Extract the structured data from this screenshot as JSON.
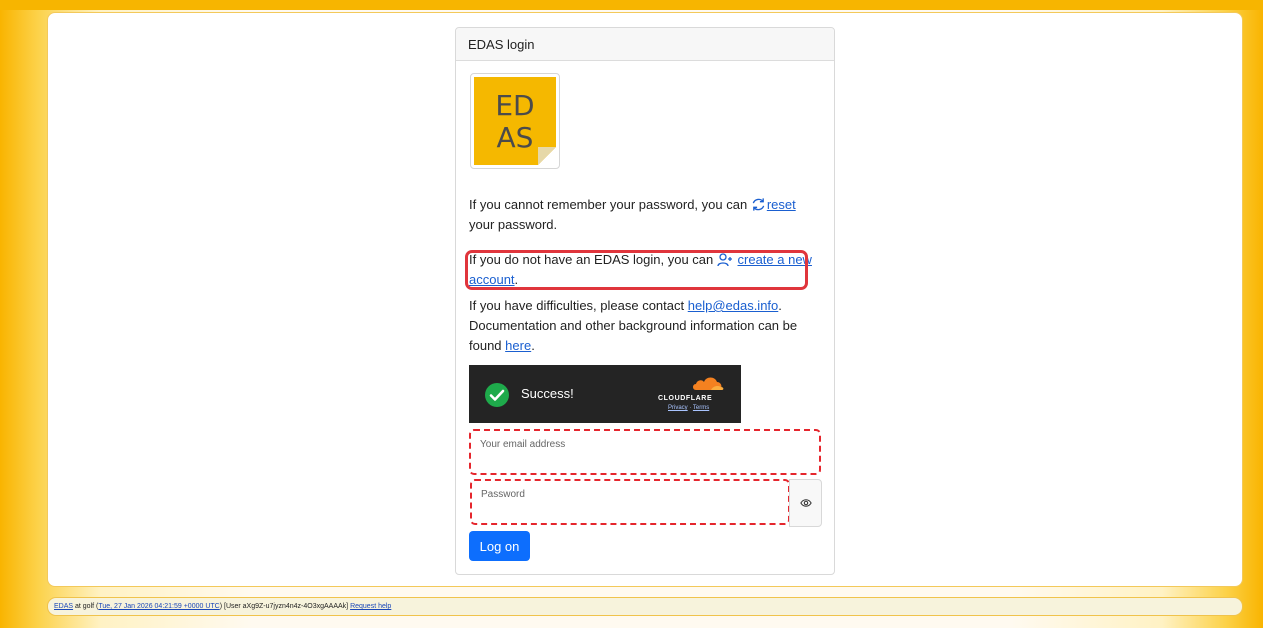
{
  "card": {
    "title": "EDAS login",
    "logo": {
      "line1": "ED",
      "line2": "AS"
    }
  },
  "reset": {
    "text_before": "If you cannot remember your password, you can ",
    "link": "reset",
    "text_after": " your password."
  },
  "create": {
    "text_before": "If you do not have an EDAS login, you can ",
    "link": "create a new account",
    "text_after": "."
  },
  "contact": {
    "text1": "If you have difficulties, please contact ",
    "email": "help@edas.info",
    "text2": ". Documentation and other background information can be found ",
    "link": "here",
    "text3": "."
  },
  "captcha": {
    "status": "Success!",
    "brand": "CLOUDFLARE",
    "privacy": "Privacy",
    "separator": " · ",
    "terms": "Terms"
  },
  "form": {
    "email_label": "Your email address",
    "email_value": "",
    "password_label": "Password",
    "password_value": "",
    "show_password_icon": "eye-icon",
    "submit_label": "Log on"
  },
  "footer": {
    "edas_link": "EDAS",
    "at": " at golf (",
    "time_link": "Tue, 27 Jan 2026 04:21:59 +0000 UTC",
    "user": ") [User aXg9Z-u7jyzn4n4z-4O3xgAAAAk] ",
    "help_link": "Request help"
  },
  "colors": {
    "primary": "#0d6efd",
    "link": "#1a5fd0",
    "highlight": "#e0353c",
    "logo_yellow": "#f5b800",
    "success_green": "#1eaa4b"
  }
}
